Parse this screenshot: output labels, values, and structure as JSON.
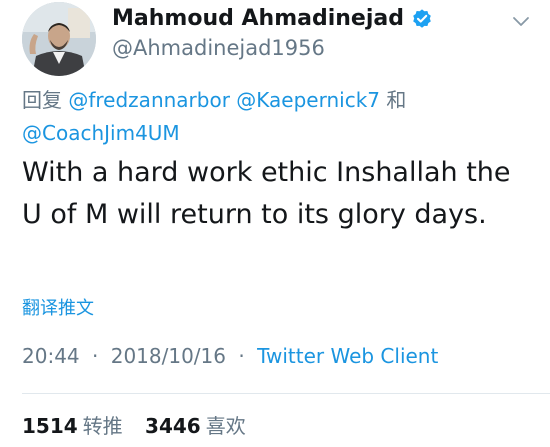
{
  "author": {
    "display_name": "Mahmoud Ahmadinejad",
    "handle": "@Ahmadinejad1956"
  },
  "reply": {
    "prefix": "回复",
    "mention_1": "@fredzannarbor",
    "mention_2": "@Kaepernick7",
    "conjunction": "和",
    "mention_3": "@CoachJim4UM"
  },
  "tweet": {
    "text": "With a hard work ethic Inshallah the U of M will return to its glory days."
  },
  "translate": {
    "label": "翻译推文"
  },
  "meta": {
    "time": "20:44",
    "separator": "·",
    "date": "2018/10/16",
    "source": "Twitter Web Client"
  },
  "stats": {
    "retweets_count": "1514",
    "retweets_label": "转推",
    "likes_count": "3446",
    "likes_label": "喜欢"
  },
  "icons": {
    "verified": "verified-badge-icon",
    "menu": "chevron-down-icon"
  },
  "colors": {
    "link_blue": "#1b95e0",
    "verified_blue": "#1da1f2",
    "secondary_text": "#657786",
    "primary_text": "#14171a"
  }
}
